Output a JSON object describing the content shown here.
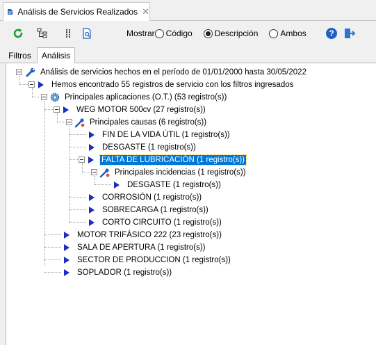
{
  "window": {
    "tab_title": "Análisis de Servicios Realizados",
    "close_glyph": "✕"
  },
  "toolbar": {
    "refresh_icon": "refresh-icon",
    "tree_icon": "tree-structure-icon",
    "columns_icon": "columns-icon",
    "document_icon": "document-icon",
    "mostrar_label": "Mostrar",
    "options": [
      {
        "label": "Código",
        "selected": false
      },
      {
        "label": "Descripción",
        "selected": true
      },
      {
        "label": "Ambos",
        "selected": false
      }
    ],
    "help_icon": "help-icon",
    "exit_icon": "exit-icon",
    "accent_color": "#1a2dbf"
  },
  "inner_tabs": [
    {
      "label": "Filtros",
      "active": false
    },
    {
      "label": "Análisis",
      "active": true
    }
  ],
  "tree": {
    "root": "Análisis de servicios hechos en el período de 01/01/2000 hasta 30/05/2022",
    "summary": "Hemos encontrado 55 registros de servicio con los filtros ingresados",
    "group": "Principales aplicaciones (O.T.) (53 registro(s))",
    "weg": "WEG MOTOR 500cv (27 registro(s))",
    "causes": "Principales causas (6 registro(s))",
    "cause_items": [
      "FIN DE LA VIDA ÚTIL (1 registro(s))",
      "DESGASTE (1 registro(s))",
      "FALTA DE LUBRICACIÓN (1 registro(s))",
      "CORROSIÓN (1 registro(s))",
      "SOBRECARGA (1 registro(s))",
      "CORTO CIRCUITO (1 registro(s))"
    ],
    "incidents": "Principales incidencias (1 registro(s))",
    "incident_item": "DESGASTE (1 registro(s))",
    "applications": [
      "MOTOR TRIFÁSICO 222 (23 registro(s))",
      "SALA DE APERTURA (1 registro(s))",
      "SECTOR DE PRODUCCION (1 registro(s))",
      "SOPLADOR (1 registro(s))"
    ],
    "selected_item": "FALTA DE LUBRICACIÓN (1 registro(s))",
    "selection_color": "#0078d7"
  }
}
